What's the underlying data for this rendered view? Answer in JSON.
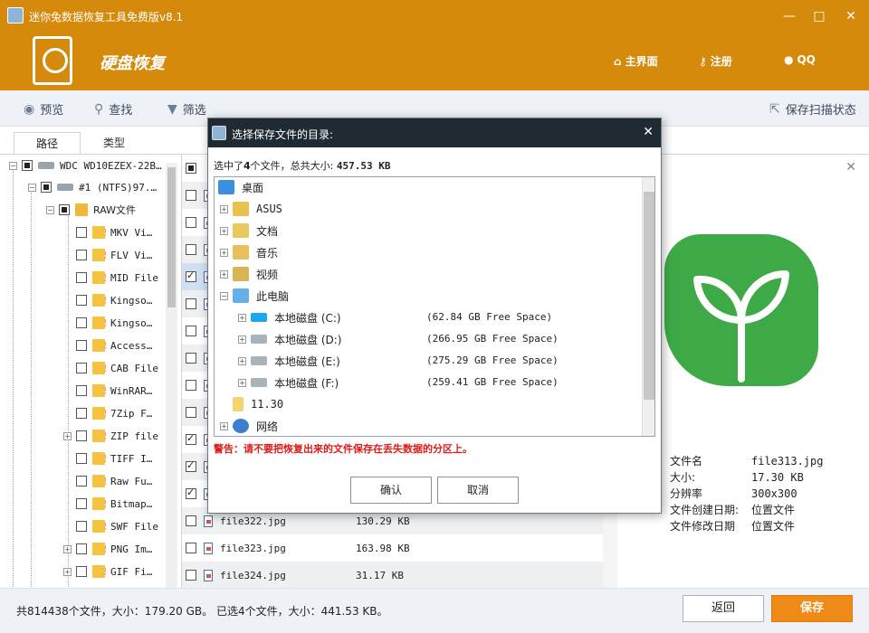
{
  "window": {
    "title": "迷你兔数据恢复工具免费版v8.1",
    "section_title": "硬盘恢复",
    "nav": {
      "home": "主界面",
      "register": "注册",
      "qq": "QQ"
    },
    "accent": "#d68a0b"
  },
  "toolbar": {
    "preview": "预览",
    "find": "查找",
    "filter": "筛选",
    "save_scan": "保存扫描状态"
  },
  "tabs": {
    "path": "路径",
    "type": "类型"
  },
  "tree": {
    "disk": "WDC WD10EZEX-22B…",
    "partition": "#1 (NTFS)97.…",
    "raw": "RAW文件",
    "items": [
      "MKV Vi…",
      "FLV Vi…",
      "MID File",
      "Kingso…",
      "Kingso…",
      "Access…",
      "CAB File",
      "WinRAR…",
      "7Zip F…",
      "ZIP file",
      "TIFF I…",
      "Raw Fu…",
      "Bitmap…",
      "SWF File",
      "PNG Im…",
      "GIF Fi…"
    ]
  },
  "files": [
    {
      "name": "file322.jpg",
      "size": "130.29 KB"
    },
    {
      "name": "file323.jpg",
      "size": "163.98 KB"
    },
    {
      "name": "file324.jpg",
      "size": "31.17 KB"
    }
  ],
  "preview": {
    "props": [
      {
        "k": "文件名",
        "v": "file313.jpg"
      },
      {
        "k": "大小:",
        "v": "17.30 KB"
      },
      {
        "k": "分辨率",
        "v": "300x300"
      },
      {
        "k": "文件创建日期:",
        "v": "位置文件"
      },
      {
        "k": "文件修改日期",
        "v": "位置文件"
      }
    ]
  },
  "dialog": {
    "title": "选择保存文件的目录:",
    "summary_prefix": "选中了",
    "summary_count": "4",
    "summary_mid": "个文件，总共大小:",
    "summary_size": "457.53 KB",
    "tree": {
      "desktop": "桌面",
      "asus": "ASUS",
      "docs": "文档",
      "music": "音乐",
      "video": "视频",
      "pc": "此电脑",
      "drives": [
        {
          "label": "本地磁盘 (C:)",
          "space": "(62.84 GB Free Space)"
        },
        {
          "label": "本地磁盘 (D:)",
          "space": "(266.95 GB Free Space)"
        },
        {
          "label": "本地磁盘 (E:)",
          "space": "(275.29 GB Free Space)"
        },
        {
          "label": "本地磁盘 (F:)",
          "space": "(259.41 GB Free Space)"
        }
      ],
      "folder": "11.30",
      "network": "网络"
    },
    "warning": "警告：请不要把恢复出来的文件保存在丢失数据的分区上。",
    "ok": "确认",
    "cancel": "取消"
  },
  "status": {
    "text": "共814438个文件，大小：179.20 GB。 已选4个文件，大小：441.53 KB。",
    "back": "返回",
    "save": "保存"
  }
}
